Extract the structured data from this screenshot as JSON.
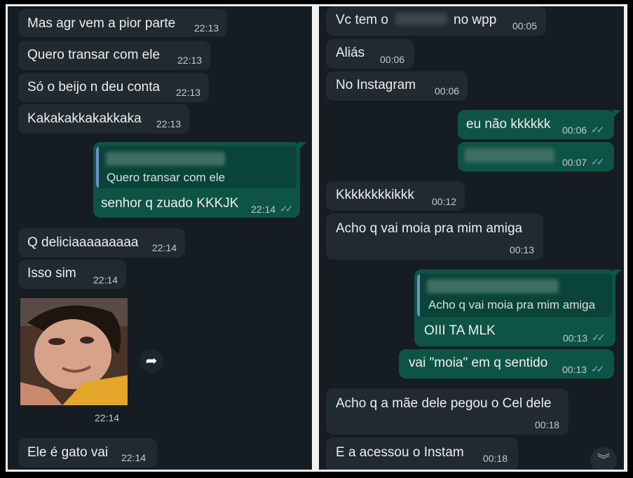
{
  "left": {
    "messages": [
      {
        "text": "Mas agr vem a pior parte",
        "time": "22:13"
      },
      {
        "text": "Quero transar com ele",
        "time": "22:13"
      },
      {
        "text": "Só o beijo n deu conta",
        "time": "22:13"
      },
      {
        "text": "Kakakakkakakkaka",
        "time": "22:13"
      },
      {
        "quote": "Quero transar com ele",
        "text": "senhor q zuado KKKJK",
        "time": "22:14"
      },
      {
        "text": "Q deliciaaaaaaaaa",
        "time": "22:14"
      },
      {
        "text": "Isso sim",
        "time": "22:14"
      },
      {
        "image_time": "22:14"
      },
      {
        "text": "Ele é gato vai",
        "time": "22:14"
      }
    ]
  },
  "right": {
    "messages": [
      {
        "text_before": "Vc tem o",
        "text_after": "no wpp",
        "time": "00:05"
      },
      {
        "text": "Aliás",
        "time": "00:06"
      },
      {
        "text": "No Instagram",
        "time": "00:06"
      },
      {
        "text": "eu não kkkkkk",
        "time": "00:06"
      },
      {
        "text": "",
        "time": "00:07"
      },
      {
        "text": "Kkkkkkkkikkk",
        "time": "00:12"
      },
      {
        "text": "Acho q vai moia pra mim amiga",
        "time": "00:13"
      },
      {
        "quote": "Acho q vai moia pra mim amiga",
        "text": "OIII TA MLK",
        "time": "00:13"
      },
      {
        "text": "vai \"moia\" em q sentido",
        "time": "00:13"
      },
      {
        "text": "Acho q a mãe dele pegou o Cel dele",
        "time": "00:18"
      },
      {
        "text": "E a acessou o Instam",
        "time": "00:18"
      }
    ]
  },
  "icons": {
    "read": "double-check-icon",
    "forward": "forward-icon",
    "scroll": "scroll-down-icon"
  },
  "colors": {
    "background": "#151c22",
    "incoming": "#212a31",
    "outgoing": "#0e5446",
    "read_check": "#7ea9c9"
  }
}
